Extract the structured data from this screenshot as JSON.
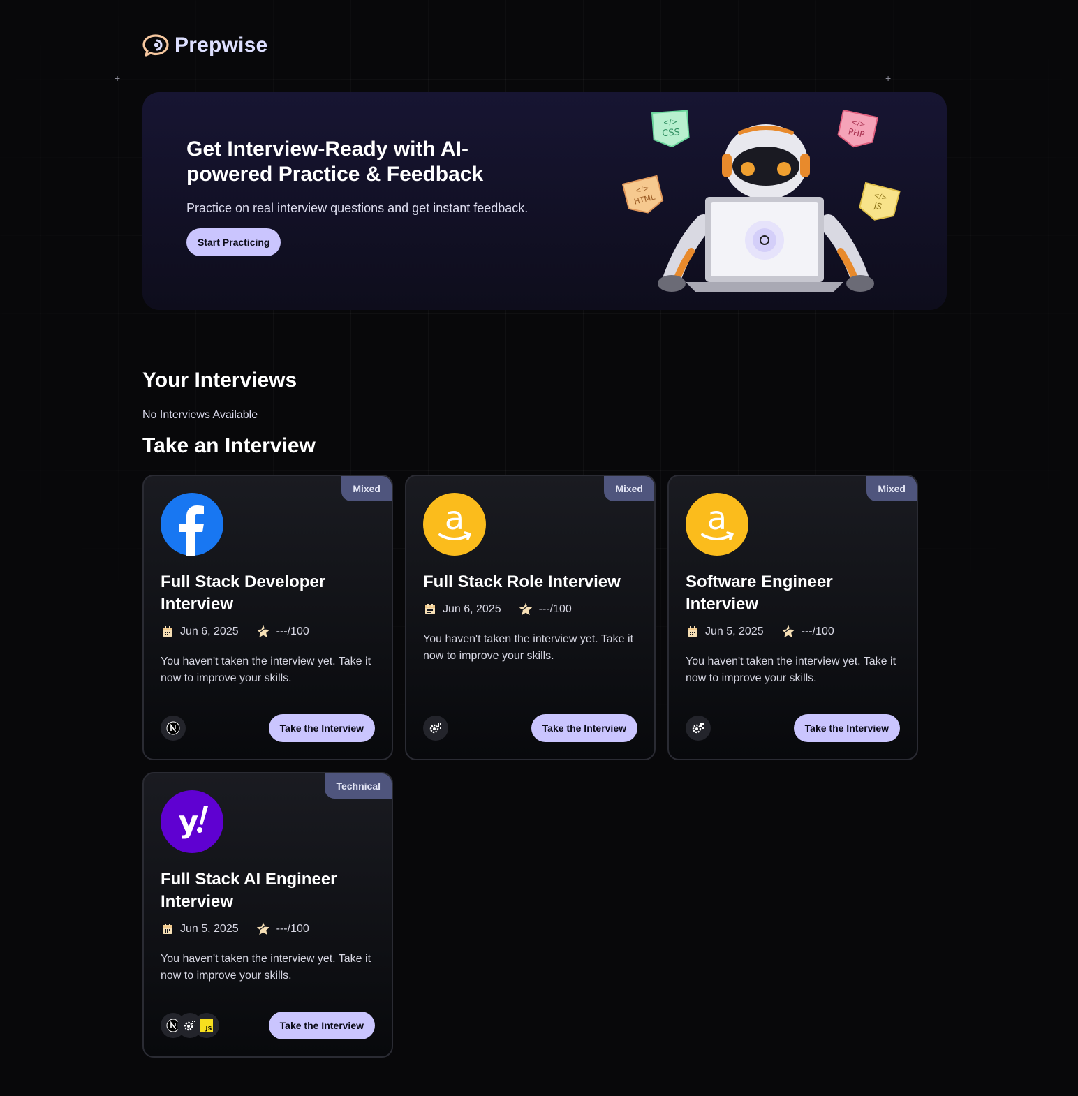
{
  "brand": {
    "name": "Prepwise"
  },
  "hero": {
    "title": "Get Interview-Ready with AI-powered Practice & Feedback",
    "subtitle": "Practice on real interview questions and get instant feedback.",
    "cta_label": "Start Practicing",
    "stickers": [
      "CSS",
      "PHP",
      "HTML",
      "JS"
    ]
  },
  "your_interviews": {
    "title": "Your Interviews",
    "empty_text": "No Interviews Available"
  },
  "take_interview": {
    "title": "Take an Interview",
    "cards": [
      {
        "badge": "Mixed",
        "company": "facebook",
        "title": "Full Stack Developer Interview",
        "date": "Jun 6, 2025",
        "score": "---/100",
        "description": "You haven't taken the interview yet. Take it now to improve your skills.",
        "tech": [
          "nextjs-icon"
        ],
        "button": "Take the Interview"
      },
      {
        "badge": "Mixed",
        "company": "amazon",
        "title": "Full Stack Role Interview",
        "date": "Jun 6, 2025",
        "score": "---/100",
        "description": "You haven't taken the interview yet. Take it now to improve your skills.",
        "tech": [
          "tech-gear-icon"
        ],
        "button": "Take the Interview"
      },
      {
        "badge": "Mixed",
        "company": "amazon",
        "title": "Software Engineer Interview",
        "date": "Jun 5, 2025",
        "score": "---/100",
        "description": "You haven't taken the interview yet. Take it now to improve your skills.",
        "tech": [
          "tech-gear-icon"
        ],
        "button": "Take the Interview"
      },
      {
        "badge": "Technical",
        "company": "yahoo",
        "title": "Full Stack AI Engineer Interview",
        "date": "Jun 5, 2025",
        "score": "---/100",
        "description": "You haven't taken the interview yet. Take it now to improve your skills.",
        "tech": [
          "nextjs-icon",
          "tech-gear-icon",
          "javascript-icon"
        ],
        "tech_js_label": "JS",
        "button": "Take the Interview"
      }
    ]
  },
  "colors": {
    "background": "#08080a",
    "accent_button": "#cac5fe",
    "badge_bg": "#4f557d",
    "facebook_blue": "#1877f2",
    "amazon_yellow": "#fbbc1c",
    "yahoo_purple": "#5f01d1"
  }
}
